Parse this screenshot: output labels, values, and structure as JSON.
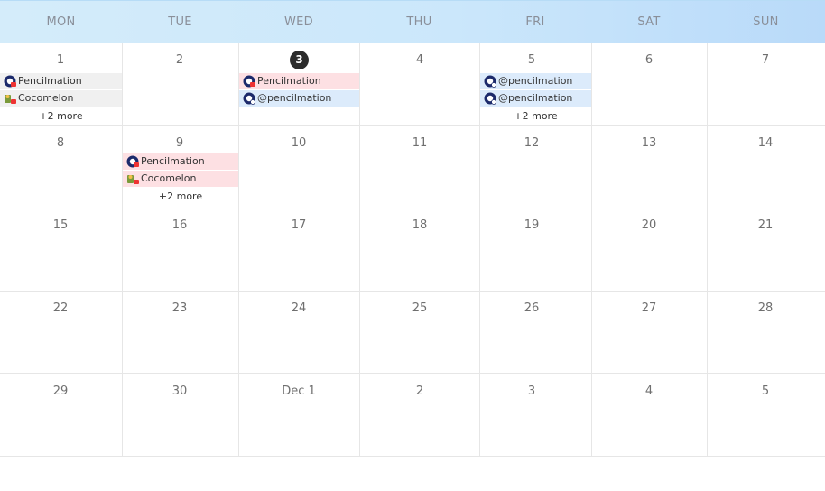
{
  "header": {
    "days": [
      "MON",
      "TUE",
      "WED",
      "THU",
      "FRI",
      "SAT",
      "SUN"
    ]
  },
  "weeks": [
    [
      "1",
      "2",
      "3",
      "4",
      "5",
      "6",
      "7"
    ],
    [
      "8",
      "9",
      "10",
      "11",
      "12",
      "13",
      "14"
    ],
    [
      "15",
      "16",
      "17",
      "18",
      "19",
      "20",
      "21"
    ],
    [
      "22",
      "23",
      "24",
      "25",
      "26",
      "27",
      "28"
    ],
    [
      "29",
      "30",
      "Dec 1",
      "2",
      "3",
      "4",
      "5"
    ]
  ],
  "events": {
    "mon1": [
      {
        "label": "Pencilmation",
        "icon": "pencilmation-icon"
      },
      {
        "label": "Cocomelon",
        "icon": "cocomelon-icon"
      }
    ],
    "mon1_more": "+2 more",
    "wed3": [
      {
        "label": "Pencilmation",
        "icon": "pencilmation-icon"
      },
      {
        "label": "@pencilmation",
        "icon": "pencilmation-icon"
      }
    ],
    "fri5": [
      {
        "label": "@pencilmation",
        "icon": "pencilmation-icon"
      },
      {
        "label": "@pencilmation",
        "icon": "pencilmation-icon"
      }
    ],
    "fri5_more": "+2 more",
    "tue9": [
      {
        "label": "Pencilmation",
        "icon": "pencilmation-icon"
      },
      {
        "label": "Cocomelon",
        "icon": "cocomelon-icon"
      }
    ],
    "tue9_more": "+2 more"
  },
  "colors": {
    "header_bg": "#cbe7fb",
    "today_badge": "#2b2b2b",
    "event_grey": "#f0f0f0",
    "event_pink": "#fde0e3",
    "event_blue": "#dcebfb"
  }
}
